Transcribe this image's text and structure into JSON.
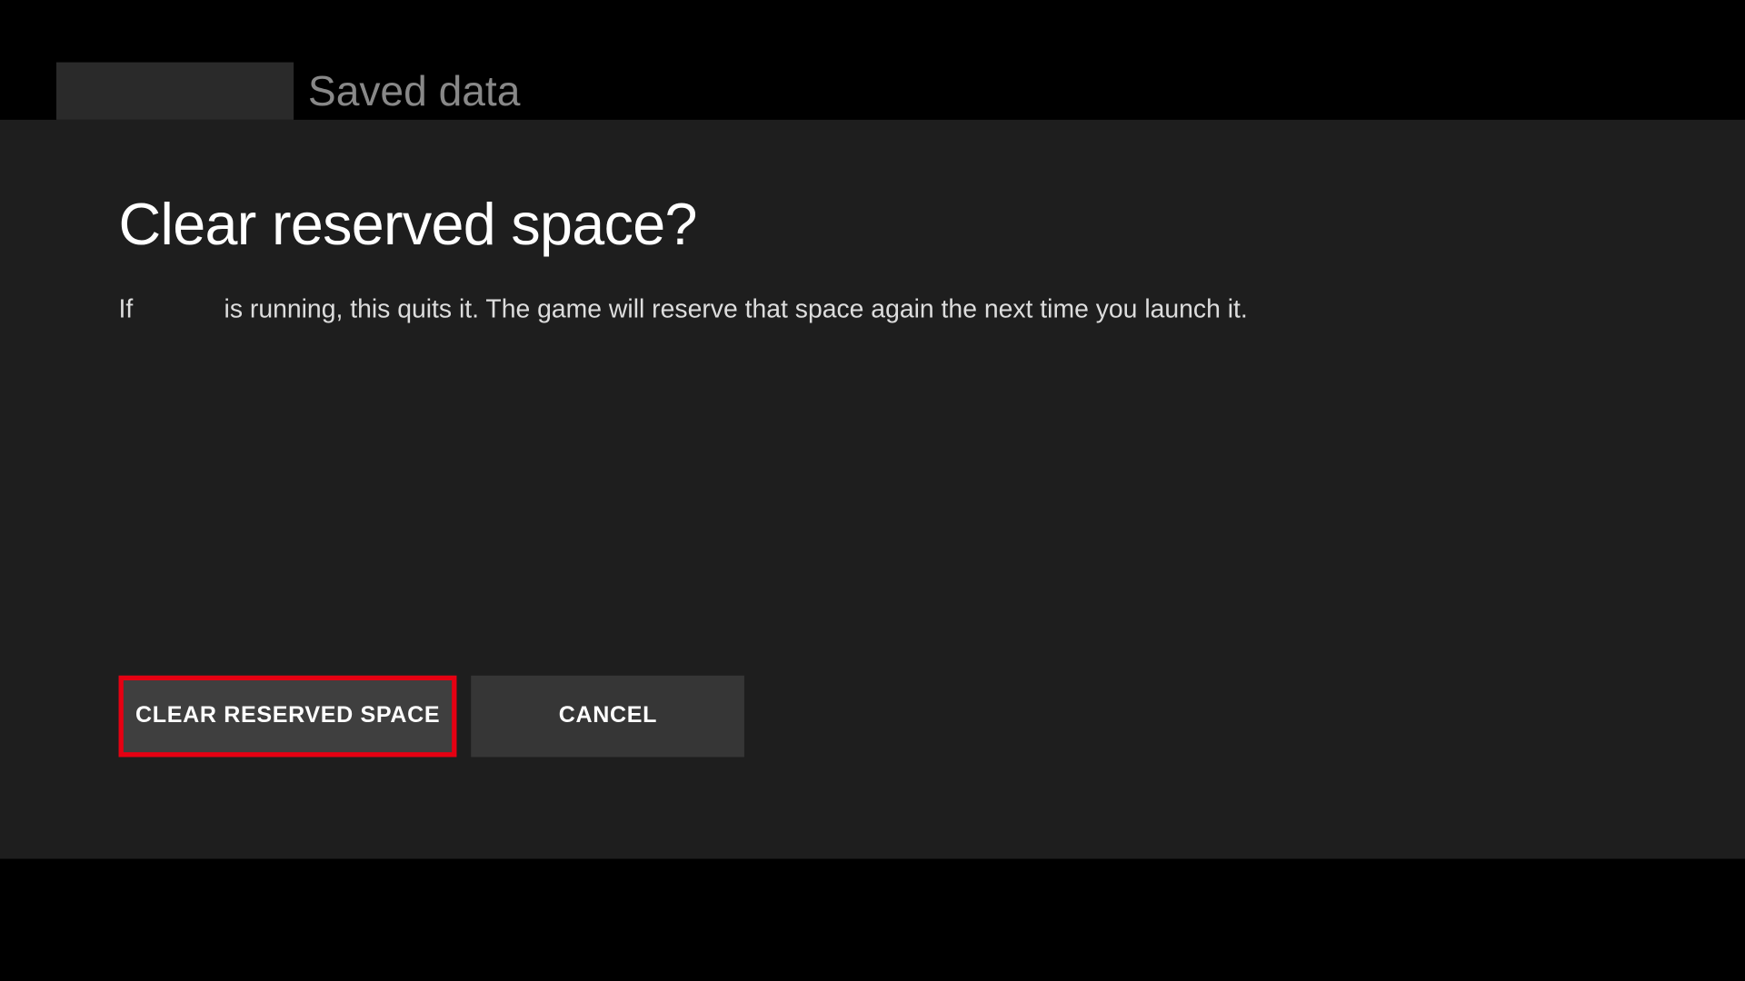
{
  "header": {
    "breadcrumb_label": "Saved data"
  },
  "dialog": {
    "title": "Clear reserved space?",
    "body_prefix": "If",
    "body_suffix": "is running, this quits it. The game will reserve that space again the next time you launch it."
  },
  "buttons": {
    "clear_label": "CLEAR RESERVED SPACE",
    "cancel_label": "CANCEL"
  }
}
